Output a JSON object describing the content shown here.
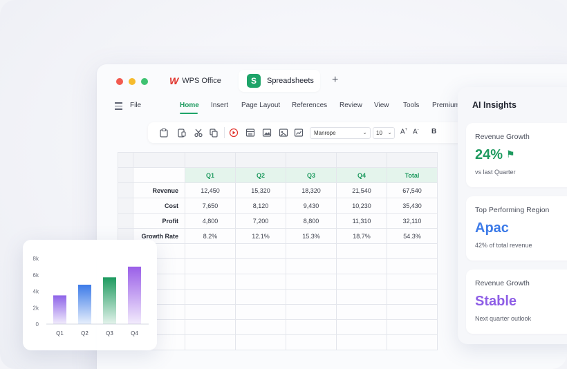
{
  "window": {
    "tabs": [
      {
        "label": "WPS Office",
        "logo": "W"
      },
      {
        "label": "Spreadsheets",
        "badge": "S"
      }
    ],
    "add_tab": "+",
    "file_menu": "File",
    "menu": [
      "Home",
      "Insert",
      "Page Layout",
      "References",
      "Review",
      "View",
      "Tools",
      "Premium"
    ],
    "active_menu": "Home"
  },
  "toolbar": {
    "font": "Manrope",
    "font_size": "10",
    "grow_font": "A",
    "shrink_font": "A",
    "bold": "B",
    "icons": [
      "paste-icon",
      "clipboard-icon",
      "cut-icon",
      "copy-icon",
      "record-icon",
      "table-icon",
      "image-icon",
      "picture-icon",
      "chart-icon"
    ]
  },
  "sheet": {
    "columns": [
      "Q1",
      "Q2",
      "Q3",
      "Q4",
      "Total"
    ],
    "rows": [
      {
        "label": "Revenue",
        "values": [
          "12,450",
          "15,320",
          "18,320",
          "21,540",
          "67,540"
        ]
      },
      {
        "label": "Cost",
        "values": [
          "7,650",
          "8,120",
          "9,430",
          "10,230",
          "35,430"
        ]
      },
      {
        "label": "Profit",
        "values": [
          "4,800",
          "7,200",
          "8,800",
          "11,310",
          "32,110"
        ]
      },
      {
        "label": "Growth Rate",
        "values": [
          "8.2%",
          "12.1%",
          "15.3%",
          "18.7%",
          "54.3%"
        ]
      }
    ]
  },
  "chart_data": {
    "type": "bar",
    "categories": [
      "Q1",
      "Q2",
      "Q3",
      "Q4"
    ],
    "values": [
      3500,
      4800,
      5700,
      7000
    ],
    "y_ticks": [
      "0",
      "2k",
      "4k",
      "6k",
      "8k"
    ],
    "ylim": [
      0,
      8000
    ],
    "colors": [
      "#8e63e8",
      "#3d7be8",
      "#1e9a5f",
      "#9a5fe8"
    ]
  },
  "insights": {
    "title": "AI Insights",
    "cards": [
      {
        "label": "Revenue Growth",
        "value": "24%",
        "sub": "vs last Quarter",
        "color": "#1e9a5f"
      },
      {
        "label": "Top Performing Region",
        "value": "Apac",
        "sub": "42% of total revenue",
        "color": "#3d7be8"
      },
      {
        "label": "Revenue Growth",
        "value": "Stable",
        "sub": "Next quarter outlook",
        "color": "#8e5ee6"
      }
    ]
  }
}
